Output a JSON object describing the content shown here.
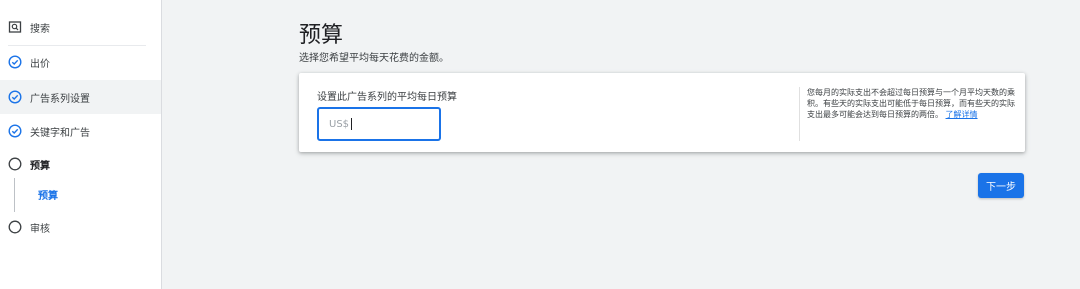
{
  "sidebar": {
    "items": [
      {
        "label": "搜索",
        "icon": "search-icon"
      },
      {
        "label": "出价",
        "icon": "check-circle-icon"
      },
      {
        "label": "广告系列设置",
        "icon": "check-circle-icon"
      },
      {
        "label": "关键字和广告",
        "icon": "check-circle-icon"
      },
      {
        "label": "预算",
        "icon": "empty-circle-icon"
      },
      {
        "label": "审核",
        "icon": "empty-circle-icon"
      }
    ],
    "sub_item": "预算"
  },
  "main": {
    "title": "预算",
    "subtitle": "选择您希望平均每天花费的金额。",
    "card": {
      "label": "设置此广告系列的平均每日预算",
      "input_placeholder": "US$",
      "help_text": "您每月的实际支出不会超过每日预算与一个月平均天数的乘积。有些天的实际支出可能低于每日预算，而有些天的实际支出最多可能会达到每日预算的两倍。",
      "help_link": "了解详情"
    },
    "next_button": "下一步"
  },
  "colors": {
    "accent": "#1a73e8",
    "background": "#f1f3f4"
  }
}
